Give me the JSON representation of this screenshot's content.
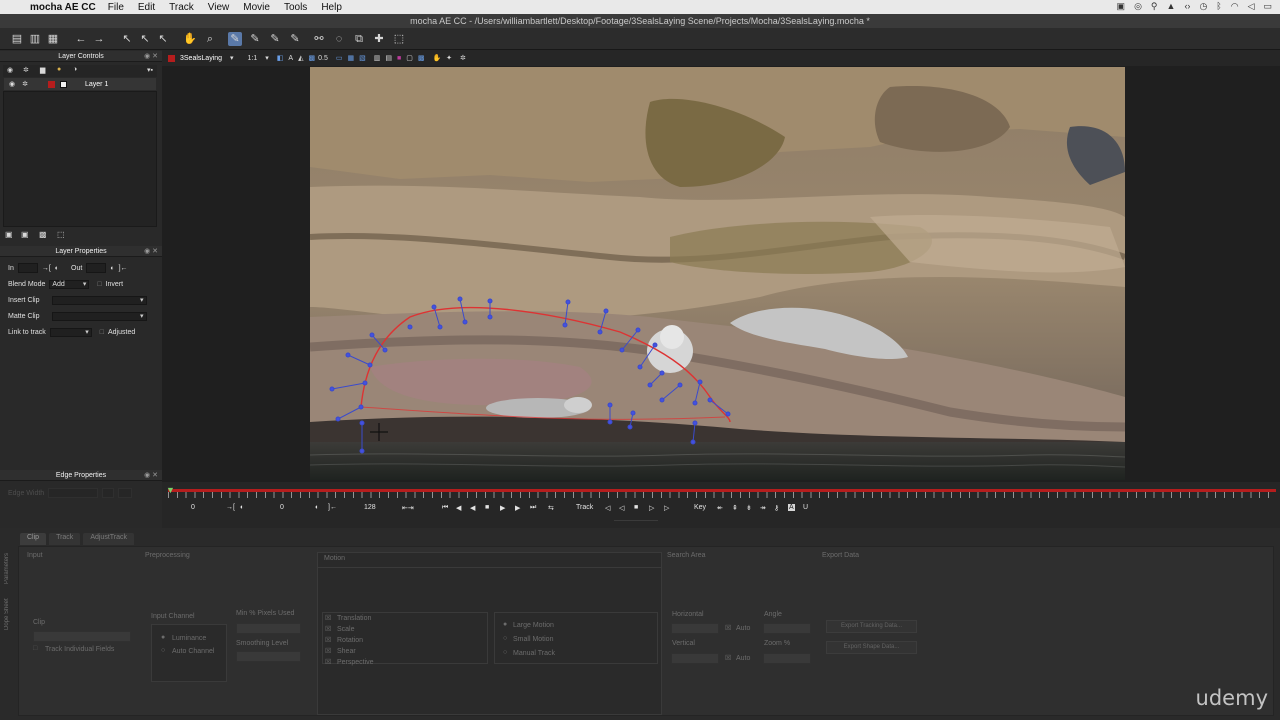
{
  "menubar": {
    "apple_icon": "apple-icon",
    "app_name": "mocha AE CC",
    "items": [
      "File",
      "Edit",
      "Track",
      "View",
      "Movie",
      "Tools",
      "Help"
    ]
  },
  "window": {
    "title": "mocha AE CC - /Users/williambartlett/Desktop/Footage/3SealsLaying Scene/Projects/Mocha/3SealsLaying.mocha *"
  },
  "layer_controls": {
    "header": "Layer Controls",
    "layers": [
      {
        "name": "Layer 1"
      }
    ]
  },
  "layer_properties": {
    "header": "Layer Properties",
    "in_label": "In",
    "out_label": "Out",
    "blend_mode_label": "Blend Mode",
    "blend_mode_value": "Add",
    "invert_label": "Invert",
    "insert_clip_label": "Insert Clip",
    "matte_clip_label": "Matte Clip",
    "link_to_track_label": "Link to track",
    "adjusted_label": "Adjusted"
  },
  "edge_properties": {
    "header": "Edge Properties",
    "edge_width_label": "Edge Width"
  },
  "viewer": {
    "clip_name": "3SealsLaying",
    "zoom": "1:1",
    "opacity": "0.5"
  },
  "timeline": {
    "in_frame": "0",
    "current_frame": "0",
    "end_frame": "128",
    "track_label": "Track",
    "key_label": "Key"
  },
  "bottom": {
    "tabs": [
      "Clip",
      "Track",
      "AdjustTrack"
    ],
    "active_tab": "Clip",
    "side_tabs": [
      "Parameters",
      "Dope Sheet"
    ],
    "sections": [
      "Input",
      "Preprocessing",
      "Motion",
      "Search Area",
      "Export Data"
    ],
    "clip_label": "Clip",
    "track_individual_fields": "Track Individual Fields",
    "input_channel_label": "Input Channel",
    "luminance": "Luminance",
    "auto_channel": "Auto Channel",
    "min_percent_pixels": "Min % Pixels Used",
    "smoothing_level": "Smoothing Level",
    "motion_options": [
      "Translation",
      "Scale",
      "Rotation",
      "Shear",
      "Perspective"
    ],
    "motion_types": [
      "Large Motion",
      "Small Motion",
      "Manual Track"
    ],
    "horizontal": "Horizontal",
    "vertical": "Vertical",
    "auto": "Auto",
    "angle": "Angle",
    "zoom_percent": "Zoom %",
    "export_tracking_data": "Export Tracking Data...",
    "export_shape_data": "Export Shape Data..."
  },
  "watermark": "udemy"
}
